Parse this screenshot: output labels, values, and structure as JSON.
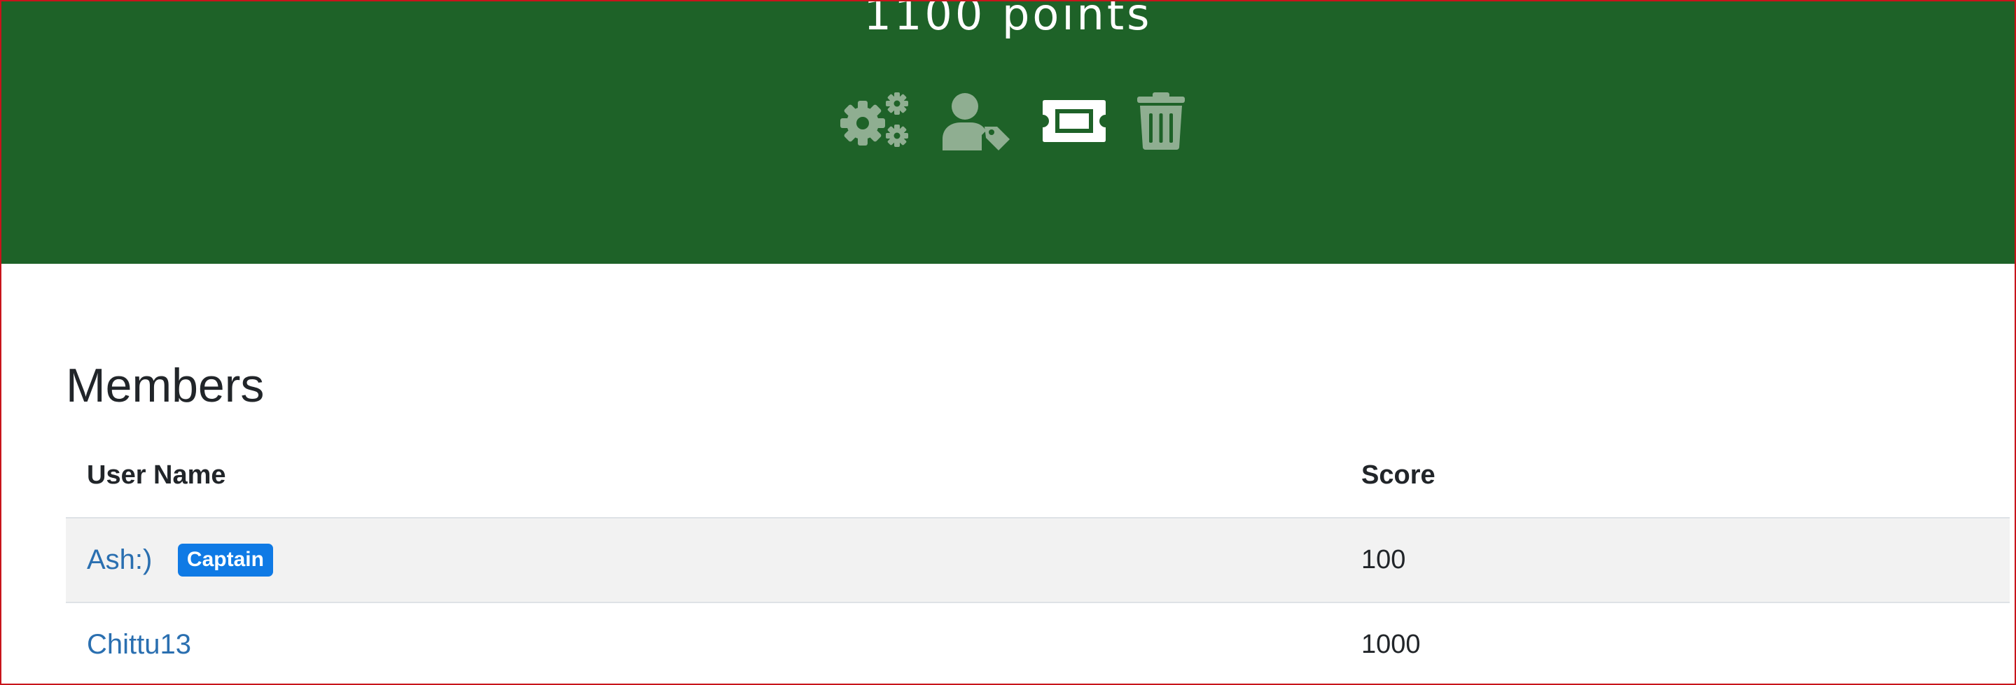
{
  "team": {
    "points_label": "1100 points"
  },
  "actions": [
    {
      "icon": "gears-icon",
      "color": "#8fae91"
    },
    {
      "icon": "user-tag-icon",
      "color": "#8fae91"
    },
    {
      "icon": "ticket-icon",
      "color": "#ffffff"
    },
    {
      "icon": "trash-icon",
      "color": "#8fae91"
    }
  ],
  "members": {
    "title": "Members",
    "columns": {
      "user_name": "User Name",
      "score": "Score"
    },
    "rows": [
      {
        "name": "Ash:)",
        "badge": "Captain",
        "score": "100"
      },
      {
        "name": "Chittu13",
        "badge": "",
        "score": "1000"
      }
    ]
  },
  "colors": {
    "banner": "#1e6228",
    "link": "#2a6fb0",
    "badge": "#0f7ae5",
    "frame_border": "#c8141b"
  }
}
